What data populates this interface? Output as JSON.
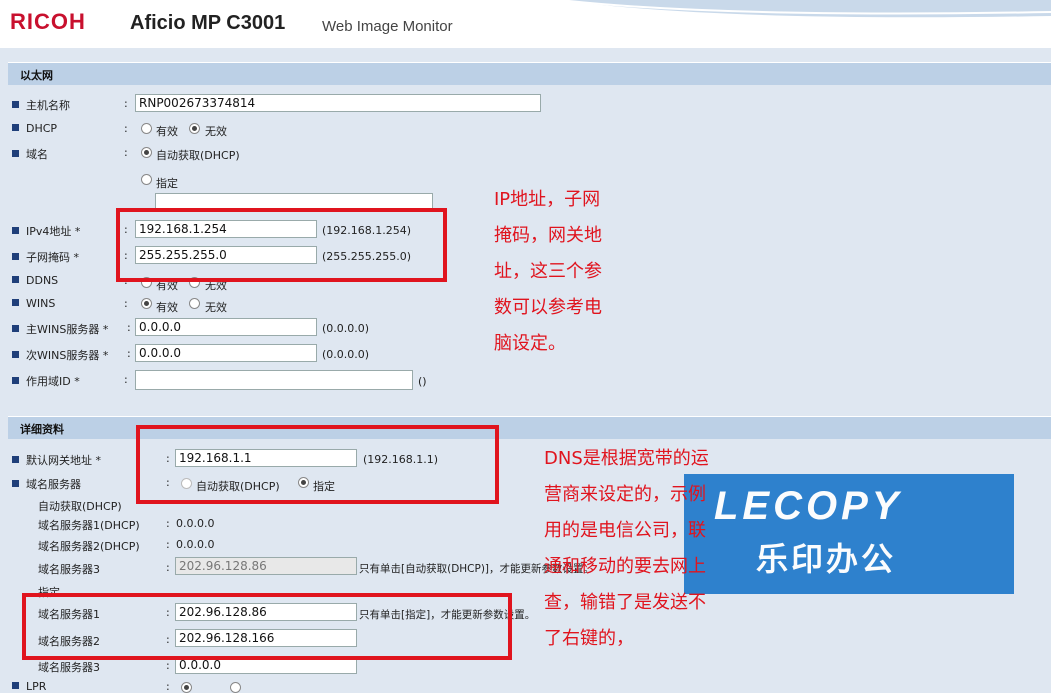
{
  "header": {
    "brand": "RICOH",
    "model": "Aficio MP C3001",
    "product": "Web Image Monitor"
  },
  "ethernet": {
    "section_title": "以太网",
    "host_name": {
      "label": "主机名称",
      "value": "RNP002673374814"
    },
    "dhcp": {
      "label": "DHCP",
      "options": [
        "有效",
        "无效"
      ],
      "selected": "无效"
    },
    "domain": {
      "label": "域名",
      "auto_label": "自动获取(DHCP)",
      "specify_label": "指定",
      "value": ""
    },
    "ipv4": {
      "label": "IPv4地址 *",
      "value": "192.168.1.254",
      "hint": "(192.168.1.254)"
    },
    "subnet": {
      "label": "子网掩码 *",
      "value": "255.255.255.0",
      "hint": "(255.255.255.0)"
    },
    "ddns": {
      "label": "DDNS",
      "options": [
        "有效",
        "无效"
      ]
    },
    "wins": {
      "label": "WINS",
      "options": [
        "有效",
        "无效"
      ],
      "selected": "有效"
    },
    "primary_wins": {
      "label": "主WINS服务器 *",
      "value": "0.0.0.0",
      "hint": "(0.0.0.0)"
    },
    "secondary_wins": {
      "label": "次WINS服务器 *",
      "value": "0.0.0.0",
      "hint": "(0.0.0.0)"
    },
    "scope_id": {
      "label": "作用域ID *",
      "value": "",
      "hint": "()"
    }
  },
  "details": {
    "section_title": "详细资料",
    "gateway": {
      "label": "默认网关地址 *",
      "value": "192.168.1.1",
      "hint": "(192.168.1.1)"
    },
    "dns": {
      "label": "域名服务器",
      "auto_label": "自动获取(DHCP)",
      "specify_label": "指定",
      "selected": "指定"
    },
    "auto_heading": "自动获取(DHCP)",
    "dns1_dhcp": {
      "label": "域名服务器1(DHCP)",
      "value": "0.0.0.0"
    },
    "dns2_dhcp": {
      "label": "域名服务器2(DHCP)",
      "value": "0.0.0.0"
    },
    "dns3_dhcp": {
      "label": "域名服务器3",
      "value": "202.96.128.86",
      "note": "只有单击[自动获取(DHCP)]，才能更新参数设置。"
    },
    "specify_heading": "指定",
    "dns1": {
      "label": "域名服务器1",
      "value": "202.96.128.86",
      "note": "只有单击[指定]，才能更新参数设置。"
    },
    "dns2": {
      "label": "域名服务器2",
      "value": "202.96.128.166"
    },
    "dns3": {
      "label": "域名服务器3",
      "value": "0.0.0.0"
    },
    "lpr": {
      "label": "LPR"
    }
  },
  "annotations": {
    "ip_note": [
      "IP地址，子网",
      "掩码，网关地",
      "址，这三个参",
      "数可以参考电",
      "脑设定。"
    ],
    "dns_note": [
      "DNS是根据宽带的运",
      "营商来设定的，示例",
      "用的是电信公司，联",
      "通和移动的要去网上",
      "查，输错了是发送不",
      "了右键的，"
    ]
  },
  "watermark": {
    "en": "LECOPY",
    "cn": "乐印办公"
  },
  "colors": {
    "brand_red": "#c8102e",
    "annotation_red": "#e0141e",
    "section_bar": "#bcd0e6",
    "page_bg": "#dfe7f1",
    "watermark_blue": "#1674c9"
  }
}
